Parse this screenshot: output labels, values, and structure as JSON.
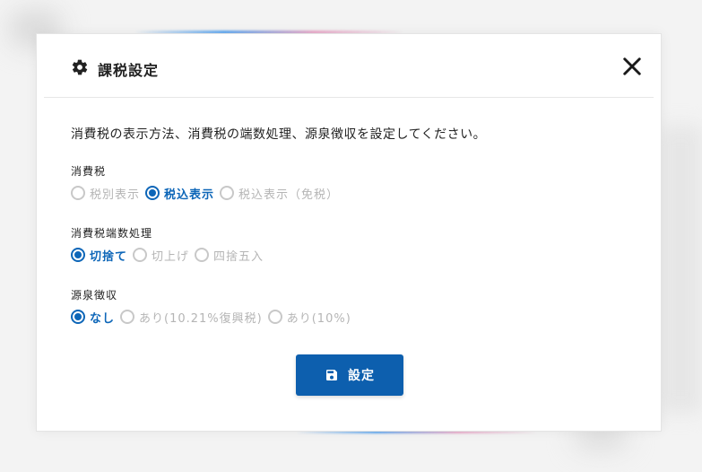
{
  "dialog": {
    "title": "課税設定",
    "description": "消費税の表示方法、消費税の端数処理、源泉徴収を設定してください。",
    "close_icon": "close-icon",
    "title_icon": "gear-icon"
  },
  "groups": [
    {
      "label": "消費税",
      "options": [
        {
          "label": "税別表示",
          "selected": false
        },
        {
          "label": "税込表示",
          "selected": true
        },
        {
          "label": "税込表示（免税）",
          "selected": false
        }
      ]
    },
    {
      "label": "消費税端数処理",
      "options": [
        {
          "label": "切捨て",
          "selected": true
        },
        {
          "label": "切上げ",
          "selected": false
        },
        {
          "label": "四捨五入",
          "selected": false
        }
      ]
    },
    {
      "label": "源泉徴収",
      "options": [
        {
          "label": "なし",
          "selected": true
        },
        {
          "label": "あり(10.21%復興税)",
          "selected": false
        },
        {
          "label": "あり(10%)",
          "selected": false
        }
      ]
    }
  ],
  "submit": {
    "label": "設定",
    "icon": "save-icon"
  },
  "colors": {
    "accent": "#0d5fae",
    "selected_radio": "#0d66b8",
    "unselected_text": "#b5b5b5"
  }
}
